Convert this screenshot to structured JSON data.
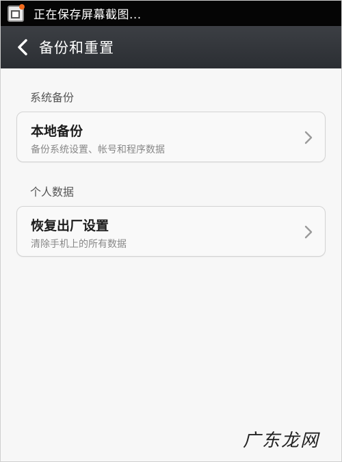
{
  "status_bar": {
    "notification_icon": "screenshot-icon",
    "text": "正在保存屏幕截图..."
  },
  "header": {
    "back_icon": "chevron-left-icon",
    "title": "备份和重置"
  },
  "sections": [
    {
      "title": "系统备份",
      "items": [
        {
          "title": "本地备份",
          "subtitle": "备份系统设置、帐号和程序数据",
          "icon": "chevron-right-icon"
        }
      ]
    },
    {
      "title": "个人数据",
      "items": [
        {
          "title": "恢复出厂设置",
          "subtitle": "清除手机上的所有数据",
          "icon": "chevron-right-icon"
        }
      ]
    }
  ],
  "watermark": "广东龙网",
  "colors": {
    "status_bar": "#050505",
    "title_bar": "#33363b",
    "background": "#f7f7f7",
    "card_border": "#d3d3d3"
  }
}
